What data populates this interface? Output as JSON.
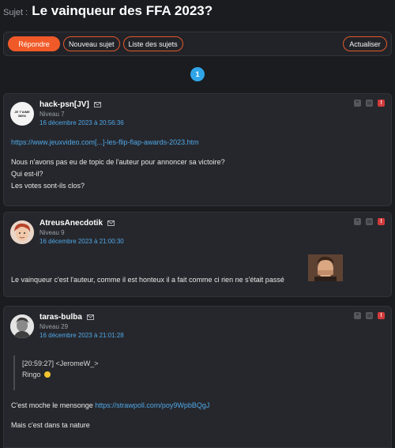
{
  "topic": {
    "subject_label": "Sujet :",
    "title": "Le vainqueur des FFA 2023?"
  },
  "toolbar": {
    "reply_label": "Répondre",
    "new_topic_label": "Nouveau sujet",
    "topic_list_label": "Liste des sujets",
    "refresh_label": "Actualiser"
  },
  "pagination": {
    "current_page": "1"
  },
  "posts": [
    {
      "author": "hack-psn[JV]",
      "level": "Niveau 7",
      "date": "16 décembre 2023 à 20:56:36",
      "avatar_text": "JE T'AIME BIEN",
      "lines": [
        "https://www.jeuxvideo.com[...]-les-flip-flap-awards-2023.htm",
        "Nous n'avons pas eu de topic de l'auteur pour annoncer sa victoire?",
        "Qui est-il?",
        "Les votes sont-ils clos?"
      ]
    },
    {
      "author": "AtreusAnecdotik",
      "level": "Niveau 9",
      "date": "16 décembre 2023 à 21:00:30",
      "lines": [
        "Le vainqueur c'est l'auteur, comme il est honteux il a fait comme ci rien ne s'était passé"
      ]
    },
    {
      "author": "taras-bulba",
      "level": "Niveau 29",
      "date": "16 décembre 2023 à 21:01:28",
      "quote": {
        "header": "[20:59:27] <JeromeW_>",
        "text": "Ringo"
      },
      "line_prefix": "C'est moche le mensonge",
      "link": "https://strawpoll.com/poy9WpbBQgJ",
      "closing": "Mais c'est dans ta nature"
    }
  ],
  "icons": {
    "mail": "envelope-icon",
    "quote": "quote-icon",
    "private_message": "private-message-icon",
    "report": "report-icon"
  },
  "colors": {
    "accent": "#f05a28",
    "link": "#4fa8e8",
    "page_badge": "#2fa5e8",
    "report": "#d23b3b"
  }
}
